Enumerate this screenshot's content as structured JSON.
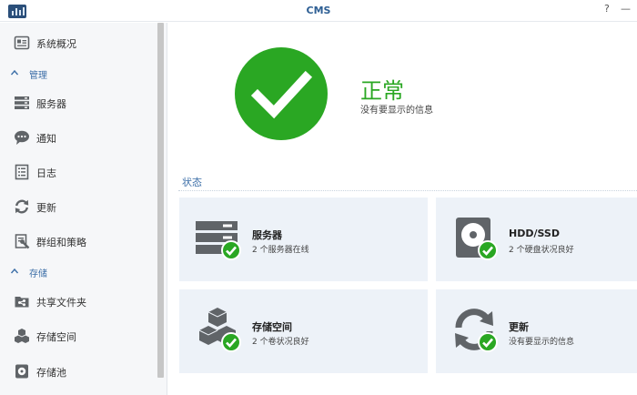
{
  "window": {
    "title": "CMS",
    "help_label": "?",
    "minimize_label": "—"
  },
  "sidebar": {
    "items": [
      {
        "label": "系统概况",
        "icon": "overview-icon"
      },
      {
        "label": "服务器",
        "icon": "server-icon"
      },
      {
        "label": "通知",
        "icon": "notification-icon"
      },
      {
        "label": "日志",
        "icon": "log-icon"
      },
      {
        "label": "更新",
        "icon": "update-icon"
      },
      {
        "label": "群组和策略",
        "icon": "group-policy-icon"
      },
      {
        "label": "共享文件夹",
        "icon": "shared-folder-icon"
      },
      {
        "label": "存储空间",
        "icon": "storage-space-icon"
      },
      {
        "label": "存储池",
        "icon": "storage-pool-icon"
      }
    ],
    "sections": [
      {
        "label": "管理"
      },
      {
        "label": "存储"
      }
    ]
  },
  "status": {
    "title": "正常",
    "subtitle": "没有要显示的信息"
  },
  "main": {
    "section_label": "状态",
    "cards": [
      {
        "title": "服务器",
        "subtitle": "2 个服务器在线",
        "icon": "server-icon"
      },
      {
        "title": "HDD/SSD",
        "subtitle": "2 个硬盘状况良好",
        "icon": "hdd-icon"
      },
      {
        "title": "存储空间",
        "subtitle": "2 个卷状况良好",
        "icon": "storage-cubes-icon"
      },
      {
        "title": "更新",
        "subtitle": "没有要显示的信息",
        "icon": "update-icon"
      }
    ]
  },
  "colors": {
    "accent": "#3d6fa8",
    "ok_green": "#2aa723",
    "card_bg": "#edf2f8",
    "icon_gray": "#606468"
  }
}
